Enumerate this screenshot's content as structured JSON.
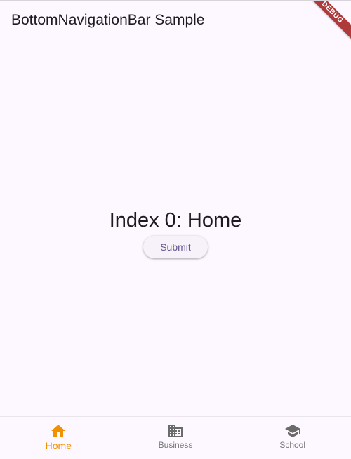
{
  "app_bar": {
    "title": "BottomNavigationBar Sample",
    "debug_label": "DEBUG"
  },
  "body": {
    "index_text": "Index 0: Home",
    "submit_label": "Submit"
  },
  "bottom_nav": {
    "selected_index": 0,
    "active_color": "#f29100",
    "inactive_color": "#757575",
    "items": [
      {
        "label": "Home",
        "icon": "home-icon"
      },
      {
        "label": "Business",
        "icon": "business-icon"
      },
      {
        "label": "School",
        "icon": "school-icon"
      }
    ]
  }
}
